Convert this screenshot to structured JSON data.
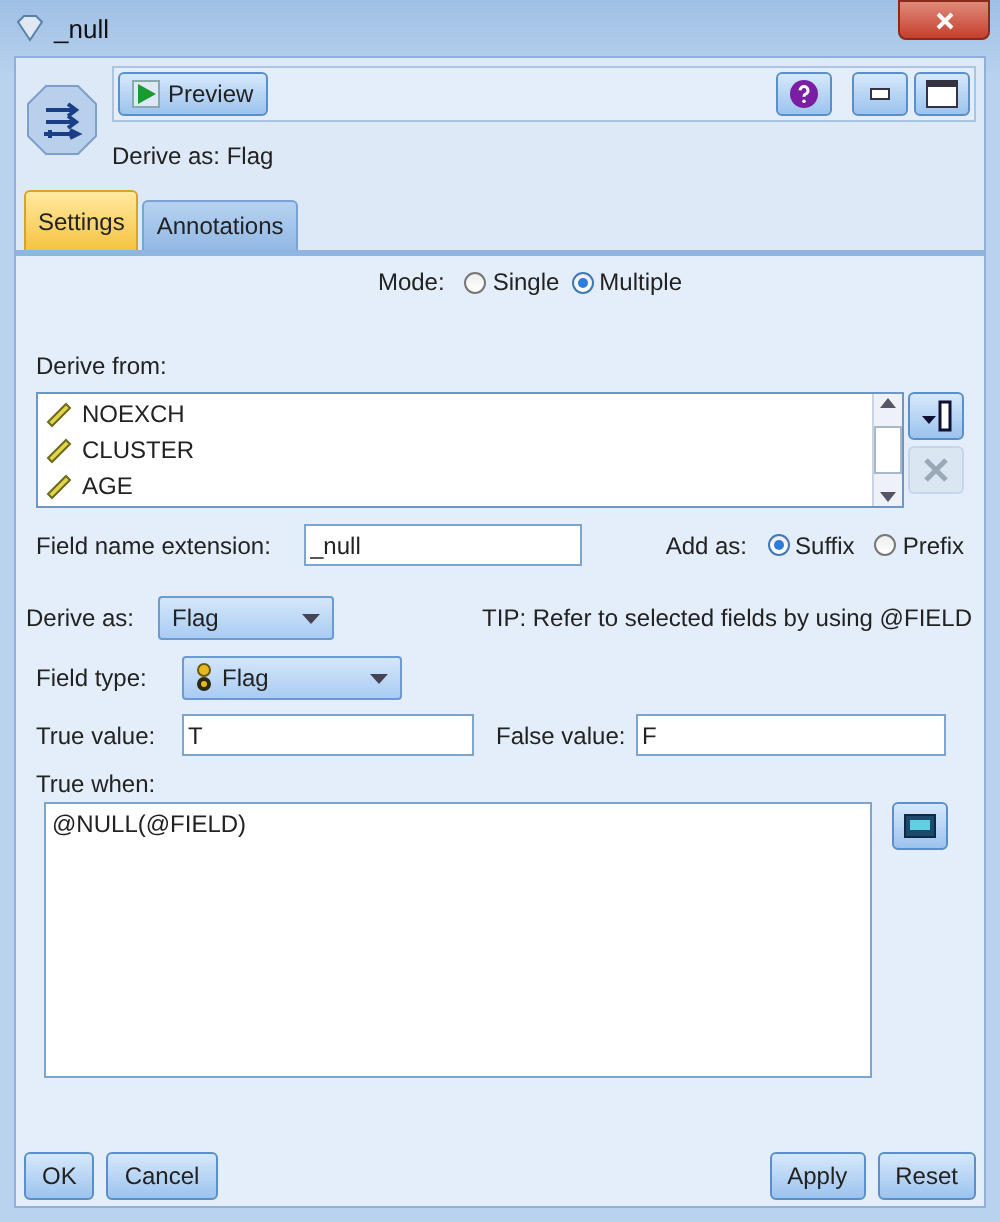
{
  "window": {
    "title": "_null"
  },
  "toolbar": {
    "preview_button": "Preview"
  },
  "subtitle": "Derive as: Flag",
  "tabs": [
    {
      "label": "Settings",
      "selected": true
    },
    {
      "label": "Annotations",
      "selected": false
    }
  ],
  "mode": {
    "label": "Mode:",
    "options": [
      {
        "label": "Single",
        "selected": false
      },
      {
        "label": "Multiple",
        "selected": true
      }
    ]
  },
  "derive_from": {
    "label": "Derive from:",
    "fields": [
      "NOEXCH",
      "CLUSTER",
      "AGE"
    ],
    "remove_disabled": true
  },
  "field_name_extension": {
    "label": "Field name extension:",
    "value": "_null"
  },
  "add_as": {
    "label": "Add as:",
    "options": [
      {
        "label": "Suffix",
        "selected": true
      },
      {
        "label": "Prefix",
        "selected": false
      }
    ]
  },
  "derive_as": {
    "label": "Derive as:",
    "value": "Flag"
  },
  "tip": "TIP: Refer to selected fields by using @FIELD",
  "field_type": {
    "label": "Field type:",
    "value": "Flag"
  },
  "true_value": {
    "label": "True value:",
    "value": "T"
  },
  "false_value": {
    "label": "False value:",
    "value": "F"
  },
  "true_when": {
    "label": "True when:",
    "value": "@NULL(@FIELD)"
  },
  "buttons_left": [
    "OK",
    "Cancel"
  ],
  "buttons_right": [
    "Apply",
    "Reset"
  ]
}
